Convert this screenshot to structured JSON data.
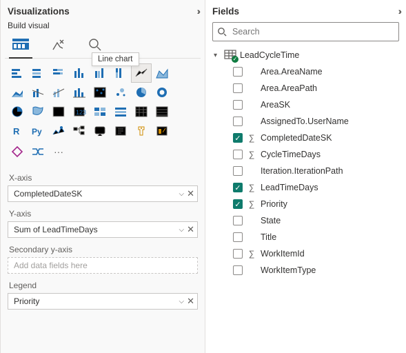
{
  "viz": {
    "title": "Visualizations",
    "sub": "Build visual",
    "tooltip": "Line chart",
    "tabs": [
      "build-visual",
      "format",
      "analytics"
    ],
    "rowTooltip": "Line chart",
    "icons": [
      "stacked-bar",
      "clustered-bar",
      "stacked-bar-100",
      "clustered-column",
      "stacked-column",
      "stacked-column-100",
      "line",
      "area",
      "stacked-area",
      "line-stacked-column",
      "line-clustered-column",
      "ribbon",
      "waterfall",
      "scatter",
      "pie",
      "donut",
      "treemap",
      "map",
      "filled-map",
      "azure-map",
      "gauge",
      "card",
      "multi-row-card",
      "kpi",
      "matrix",
      "table",
      "r-visual",
      "py-visual",
      "key-influencers",
      "decomposition-tree",
      "qna",
      "smart-narrative",
      "paginated",
      "power-apps",
      "power-automate",
      "slicer",
      "custom-visual",
      "arcgis",
      "more"
    ],
    "grid": {
      "cols": 8,
      "cells": [
        "bar-h",
        "bar-h2",
        "bar-h3",
        "col-v",
        "col-v2",
        "col-v3",
        "line",
        "area",
        "area2",
        "combo1",
        "combo2",
        "ribbon",
        "waterfall",
        "funnel",
        "scatter",
        "pie",
        "donut",
        "treemap",
        "map",
        "filled-map",
        "shape-map",
        "gauge",
        "card",
        "kpi",
        "r",
        "py",
        "key",
        "tree",
        "qna",
        "narrative",
        "pbi",
        "arcgis"
      ]
    },
    "wells": {
      "xaxis": {
        "label": "X-axis",
        "value": "CompletedDateSK"
      },
      "yaxis": {
        "label": "Y-axis",
        "value": "Sum of LeadTimeDays"
      },
      "secy": {
        "label": "Secondary y-axis",
        "placeholder": "Add data fields here"
      },
      "legend": {
        "label": "Legend",
        "value": "Priority"
      }
    }
  },
  "fields": {
    "title": "Fields",
    "searchPlaceholder": "Search",
    "table": "LeadCycleTime",
    "items": [
      {
        "name": "Area.AreaName",
        "checked": false,
        "sigma": false
      },
      {
        "name": "Area.AreaPath",
        "checked": false,
        "sigma": false
      },
      {
        "name": "AreaSK",
        "checked": false,
        "sigma": false
      },
      {
        "name": "AssignedTo.UserName",
        "checked": false,
        "sigma": false
      },
      {
        "name": "CompletedDateSK",
        "checked": true,
        "sigma": true
      },
      {
        "name": "CycleTimeDays",
        "checked": false,
        "sigma": true
      },
      {
        "name": "Iteration.IterationPath",
        "checked": false,
        "sigma": false
      },
      {
        "name": "LeadTimeDays",
        "checked": true,
        "sigma": true
      },
      {
        "name": "Priority",
        "checked": true,
        "sigma": true
      },
      {
        "name": "State",
        "checked": false,
        "sigma": false
      },
      {
        "name": "Title",
        "checked": false,
        "sigma": false
      },
      {
        "name": "WorkItemId",
        "checked": false,
        "sigma": true
      },
      {
        "name": "WorkItemType",
        "checked": false,
        "sigma": false
      }
    ]
  }
}
